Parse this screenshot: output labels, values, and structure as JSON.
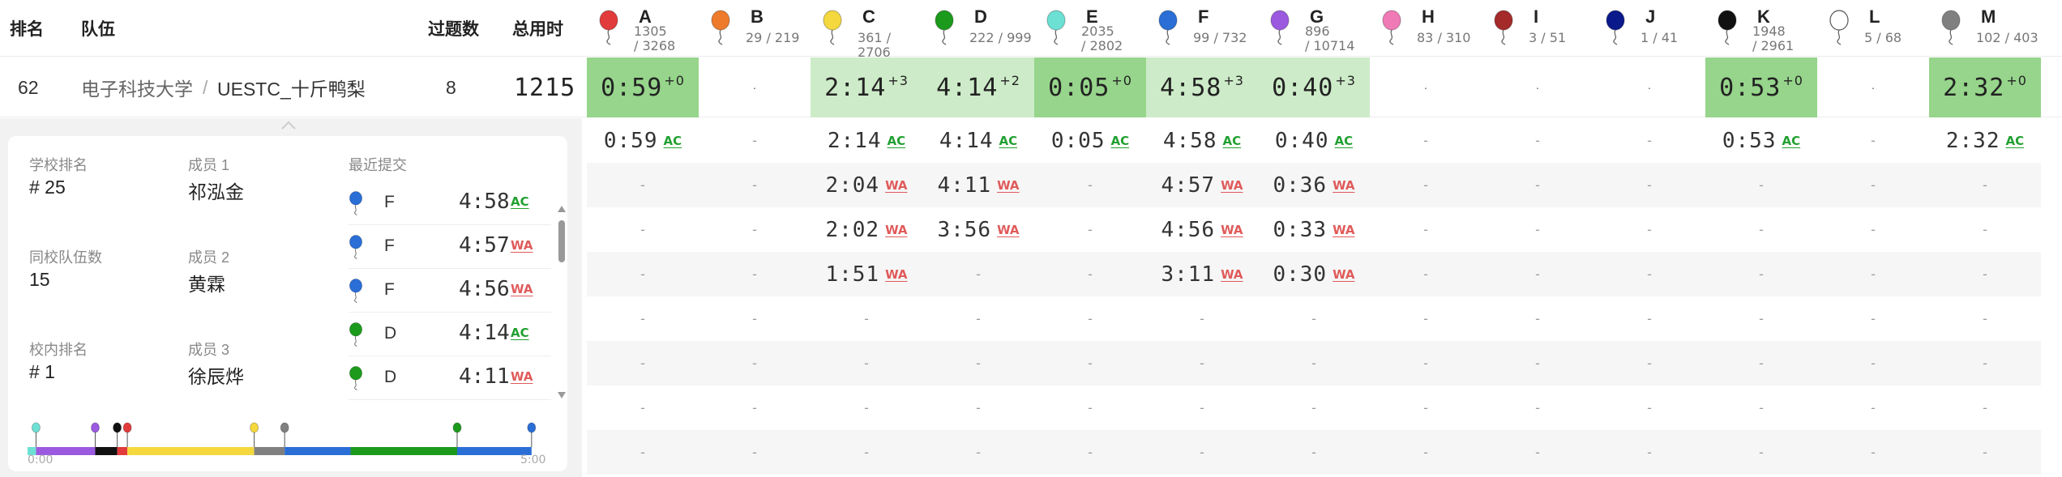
{
  "header": {
    "rank": "排名",
    "team": "队伍",
    "solved": "过题数",
    "penalty": "总用时"
  },
  "problems": [
    {
      "letter": "A",
      "color": "#e23b3b",
      "stats1": "1305",
      "stats2": "/ 3268"
    },
    {
      "letter": "B",
      "color": "#ee7a2c",
      "stats1": "29 / 219",
      "stats2": ""
    },
    {
      "letter": "C",
      "color": "#f4d83e",
      "stats1": "361 / 2706",
      "stats2": ""
    },
    {
      "letter": "D",
      "color": "#1c9a1c",
      "stats1": "222 / 999",
      "stats2": ""
    },
    {
      "letter": "E",
      "color": "#6de0d4",
      "stats1": "2035",
      "stats2": "/ 2802"
    },
    {
      "letter": "F",
      "color": "#2a6ed6",
      "stats1": "99 / 732",
      "stats2": ""
    },
    {
      "letter": "G",
      "color": "#9b59e0",
      "stats1": "896",
      "stats2": "/ 10714"
    },
    {
      "letter": "H",
      "color": "#f07ab6",
      "stats1": "83 / 310",
      "stats2": ""
    },
    {
      "letter": "I",
      "color": "#a52a2a",
      "stats1": "3 / 51",
      "stats2": ""
    },
    {
      "letter": "J",
      "color": "#0a1a8a",
      "stats1": "1 / 41",
      "stats2": ""
    },
    {
      "letter": "K",
      "color": "#111111",
      "stats1": "1948",
      "stats2": "/ 2961"
    },
    {
      "letter": "L",
      "color": "#ffffff",
      "stats1": "5 / 68",
      "stats2": ""
    },
    {
      "letter": "M",
      "color": "#808080",
      "stats1": "102 / 403",
      "stats2": ""
    }
  ],
  "team": {
    "rank": "62",
    "school": "电子科技大学",
    "separator": "/",
    "name": "UESTC_十斤鸭梨",
    "solved": "8",
    "penalty": "1215",
    "results": [
      {
        "status": "first",
        "time": "0:59",
        "tries": "+0"
      },
      {
        "status": "none",
        "dot": "·"
      },
      {
        "status": "solved",
        "time": "2:14",
        "tries": "+3"
      },
      {
        "status": "solved",
        "time": "4:14",
        "tries": "+2"
      },
      {
        "status": "first",
        "time": "0:05",
        "tries": "+0"
      },
      {
        "status": "solved",
        "time": "4:58",
        "tries": "+3"
      },
      {
        "status": "solved",
        "time": "0:40",
        "tries": "+3"
      },
      {
        "status": "none",
        "dot": "·"
      },
      {
        "status": "none",
        "dot": "·"
      },
      {
        "status": "none",
        "dot": "·"
      },
      {
        "status": "first",
        "time": "0:53",
        "tries": "+0"
      },
      {
        "status": "none",
        "dot": "·"
      },
      {
        "status": "first",
        "time": "2:32",
        "tries": "+0"
      }
    ]
  },
  "submissions": [
    [
      {
        "t": "0:59",
        "r": "AC"
      }
    ],
    [],
    [
      {
        "t": "2:14",
        "r": "AC"
      },
      {
        "t": "2:04",
        "r": "WA"
      },
      {
        "t": "2:02",
        "r": "WA"
      },
      {
        "t": "1:51",
        "r": "WA"
      }
    ],
    [
      {
        "t": "4:14",
        "r": "AC"
      },
      {
        "t": "4:11",
        "r": "WA"
      },
      {
        "t": "3:56",
        "r": "WA"
      }
    ],
    [
      {
        "t": "0:05",
        "r": "AC"
      }
    ],
    [
      {
        "t": "4:58",
        "r": "AC"
      },
      {
        "t": "4:57",
        "r": "WA"
      },
      {
        "t": "4:56",
        "r": "WA"
      },
      {
        "t": "3:11",
        "r": "WA"
      }
    ],
    [
      {
        "t": "0:40",
        "r": "AC"
      },
      {
        "t": "0:36",
        "r": "WA"
      },
      {
        "t": "0:33",
        "r": "WA"
      },
      {
        "t": "0:30",
        "r": "WA"
      }
    ],
    [],
    [],
    [],
    [
      {
        "t": "0:53",
        "r": "AC"
      }
    ],
    [],
    [
      {
        "t": "2:32",
        "r": "AC"
      }
    ]
  ],
  "empty_mark": "-",
  "panel": {
    "school_rank_label": "学校排名",
    "school_rank_value": "# 25",
    "same_school_label": "同校队伍数",
    "same_school_value": "15",
    "in_school_rank_label": "校内排名",
    "in_school_rank_value": "# 1",
    "member1_label": "成员 1",
    "member1_value": "祁泓金",
    "member2_label": "成员 2",
    "member2_value": "黄霖",
    "member3_label": "成员 3",
    "member3_value": "徐辰烨",
    "recent_label": "最近提交",
    "recent": [
      {
        "p": "F",
        "color": "#2a6ed6",
        "t": "4:58",
        "r": "AC"
      },
      {
        "p": "F",
        "color": "#2a6ed6",
        "t": "4:57",
        "r": "WA"
      },
      {
        "p": "F",
        "color": "#2a6ed6",
        "t": "4:56",
        "r": "WA"
      },
      {
        "p": "D",
        "color": "#1c9a1c",
        "t": "4:14",
        "r": "AC"
      },
      {
        "p": "D",
        "color": "#1c9a1c",
        "t": "4:11",
        "r": "WA"
      }
    ],
    "timeline_start": "0:00",
    "timeline_end": "5:00",
    "timeline_segments": [
      {
        "from": 0,
        "to": 5,
        "color": "#6de0d4"
      },
      {
        "from": 5,
        "to": 40,
        "color": "#9b59e0"
      },
      {
        "from": 40,
        "to": 53,
        "color": "#111111"
      },
      {
        "from": 53,
        "to": 59,
        "color": "#e23b3b"
      },
      {
        "from": 59,
        "to": 134,
        "color": "#f4d83e"
      },
      {
        "from": 134,
        "to": 152,
        "color": "#808080"
      },
      {
        "from": 152,
        "to": 191,
        "color": "#2a6ed6"
      },
      {
        "from": 191,
        "to": 254,
        "color": "#1c9a1c"
      },
      {
        "from": 254,
        "to": 298,
        "color": "#2a6ed6"
      }
    ],
    "timeline_markers": [
      {
        "at": 5,
        "color": "#6de0d4"
      },
      {
        "at": 40,
        "color": "#9b59e0"
      },
      {
        "at": 53,
        "color": "#111111"
      },
      {
        "at": 59,
        "color": "#e23b3b"
      },
      {
        "at": 134,
        "color": "#f4d83e"
      },
      {
        "at": 152,
        "color": "#808080"
      },
      {
        "at": 254,
        "color": "#1c9a1c"
      },
      {
        "at": 298,
        "color": "#2a6ed6"
      }
    ]
  }
}
